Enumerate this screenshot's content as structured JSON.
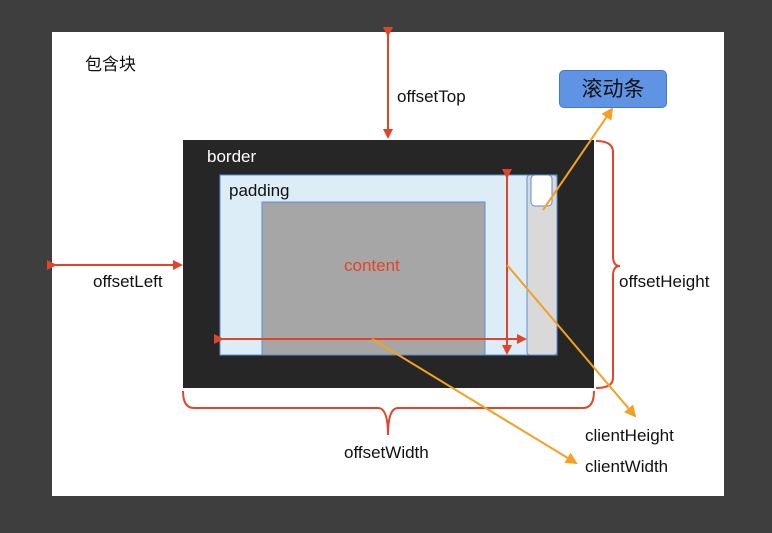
{
  "labels": {
    "containing_block": "包含块",
    "offset_top": "offsetTop",
    "scrollbar": "滚动条",
    "border": "border",
    "padding": "padding",
    "content": "content",
    "offset_left": "offsetLeft",
    "offset_height": "offsetHeight",
    "offset_width": "offsetWidth",
    "client_height": "clientHeight",
    "client_width": "clientWidth"
  },
  "colors": {
    "page_background": "#3e3e3e",
    "containing_block": "#ffffff",
    "border_box": "#262626",
    "padding_box": "#dcedf8",
    "padding_box_stroke": "#5b8fd6",
    "content_box": "#a6a6a6",
    "scrollbar_track": "#d9d9d9",
    "scrollbar_thumb": "#ffffff",
    "measure_arrows": "#e2442a",
    "pointer_arrows": "#f4a020",
    "scrollbar_badge": "#5f93e4"
  }
}
